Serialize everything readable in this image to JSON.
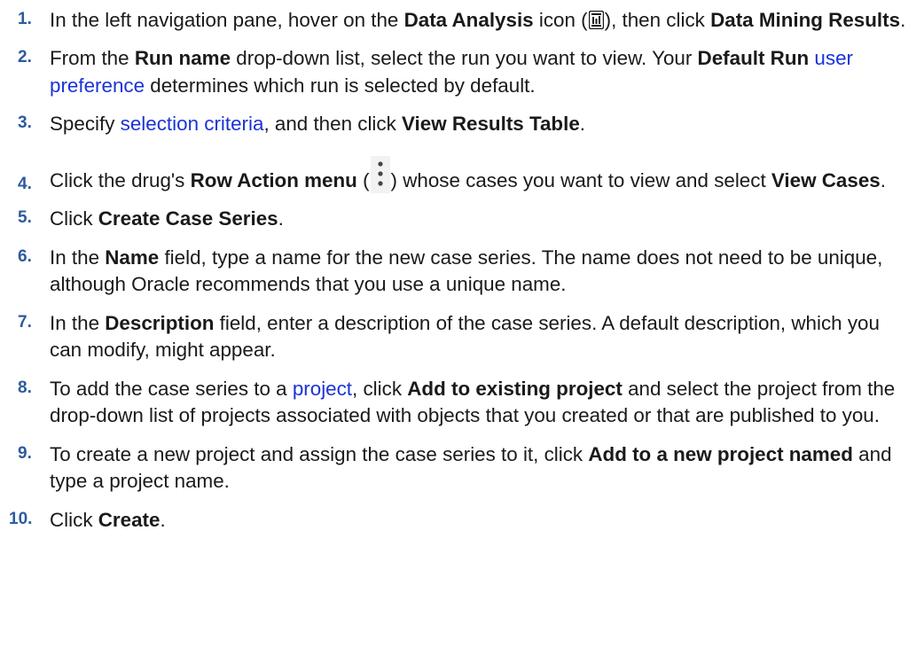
{
  "steps": [
    {
      "number": "1.",
      "text1": "In the left navigation pane, hover on the ",
      "bold1": "Data Analysis",
      "text2": " icon (",
      "icon": "data-analysis-icon",
      "text3": "), then click ",
      "bold2": "Data Mining Results",
      "text4": "."
    },
    {
      "number": "2.",
      "text1": "From the ",
      "bold1": "Run name",
      "text2": " drop-down list, select the run you want to view. Your ",
      "bold2": "Default Run",
      "text3": " ",
      "link": "user preference",
      "text4": " determines which run is selected by default."
    },
    {
      "number": "3.",
      "text1": "Specify ",
      "link": "selection criteria",
      "text2": ", and then click ",
      "bold1": "View Results Table",
      "text3": "."
    },
    {
      "number": "4.",
      "text1": "Click the drug's ",
      "bold1": "Row Action menu",
      "text2": " (",
      "icon": "row-action-menu-icon",
      "text3": ") whose cases you want to view and select ",
      "bold2": "View Cases",
      "text4": "."
    },
    {
      "number": "5.",
      "text1": "Click ",
      "bold1": "Create Case Series",
      "text2": "."
    },
    {
      "number": "6.",
      "text1": "In the ",
      "bold1": "Name",
      "text2": " field, type a name for the new case series. The name does not need to be unique, although Oracle recommends that you use a unique name."
    },
    {
      "number": "7.",
      "text1": "In the ",
      "bold1": "Description",
      "text2": " field, enter a description of the case series. A default description, which you can modify, might appear."
    },
    {
      "number": "8.",
      "text1": "To add the case series to a ",
      "link": "project",
      "text2": ", click ",
      "bold1": "Add to existing project",
      "text3": " and select the project from the drop-down list of projects associated with objects that you created or that are published to you."
    },
    {
      "number": "9.",
      "text1": "To create a new project and assign the case series to it, click ",
      "bold1": "Add to a new project named",
      "text2": " and type a project name."
    },
    {
      "number": "10.",
      "text1": "Click ",
      "bold1": "Create",
      "text2": "."
    }
  ],
  "colors": {
    "number": "#2d5b9e",
    "link": "#1a33d6",
    "text": "#1a1a1a"
  }
}
